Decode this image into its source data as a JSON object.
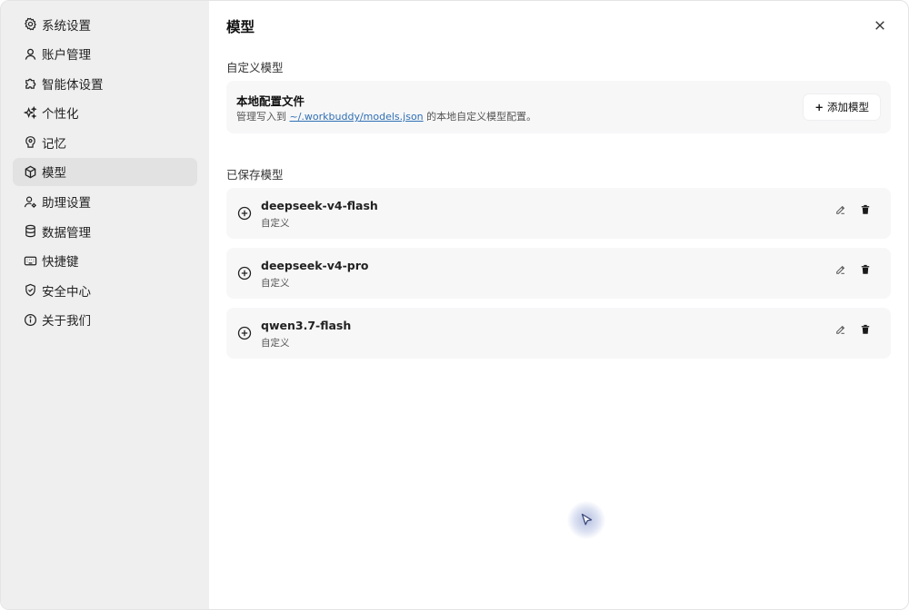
{
  "sidebar": {
    "items": [
      {
        "label": "系统设置",
        "icon": "gear-icon"
      },
      {
        "label": "账户管理",
        "icon": "user-icon"
      },
      {
        "label": "智能体设置",
        "icon": "puzzle-icon"
      },
      {
        "label": "个性化",
        "icon": "sparkles-icon"
      },
      {
        "label": "记忆",
        "icon": "brain-icon"
      },
      {
        "label": "模型",
        "icon": "cube-icon",
        "active": true
      },
      {
        "label": "助理设置",
        "icon": "user-gear-icon"
      },
      {
        "label": "数据管理",
        "icon": "database-icon"
      },
      {
        "label": "快捷键",
        "icon": "keyboard-icon"
      },
      {
        "label": "安全中心",
        "icon": "shield-icon"
      },
      {
        "label": "关于我们",
        "icon": "info-icon"
      }
    ]
  },
  "main": {
    "title": "模型",
    "custom_section_label": "自定义模型",
    "config": {
      "title": "本地配置文件",
      "desc_prefix": "管理写入到",
      "desc_link": "~/.workbuddy/models.json",
      "desc_suffix": "的本地自定义模型配置。",
      "add_button_label": "添加模型"
    },
    "saved_section_label": "已保存模型",
    "models": [
      {
        "name": "deepseek-v4-flash",
        "type": "自定义"
      },
      {
        "name": "deepseek-v4-pro",
        "type": "自定义"
      },
      {
        "name": "qwen3.7-flash",
        "type": "自定义"
      }
    ]
  },
  "colors": {
    "sidebar_bg": "#efefef",
    "active_item_bg": "#e2e2e2",
    "card_bg": "#f7f7f8",
    "link": "#2f6fb3"
  }
}
